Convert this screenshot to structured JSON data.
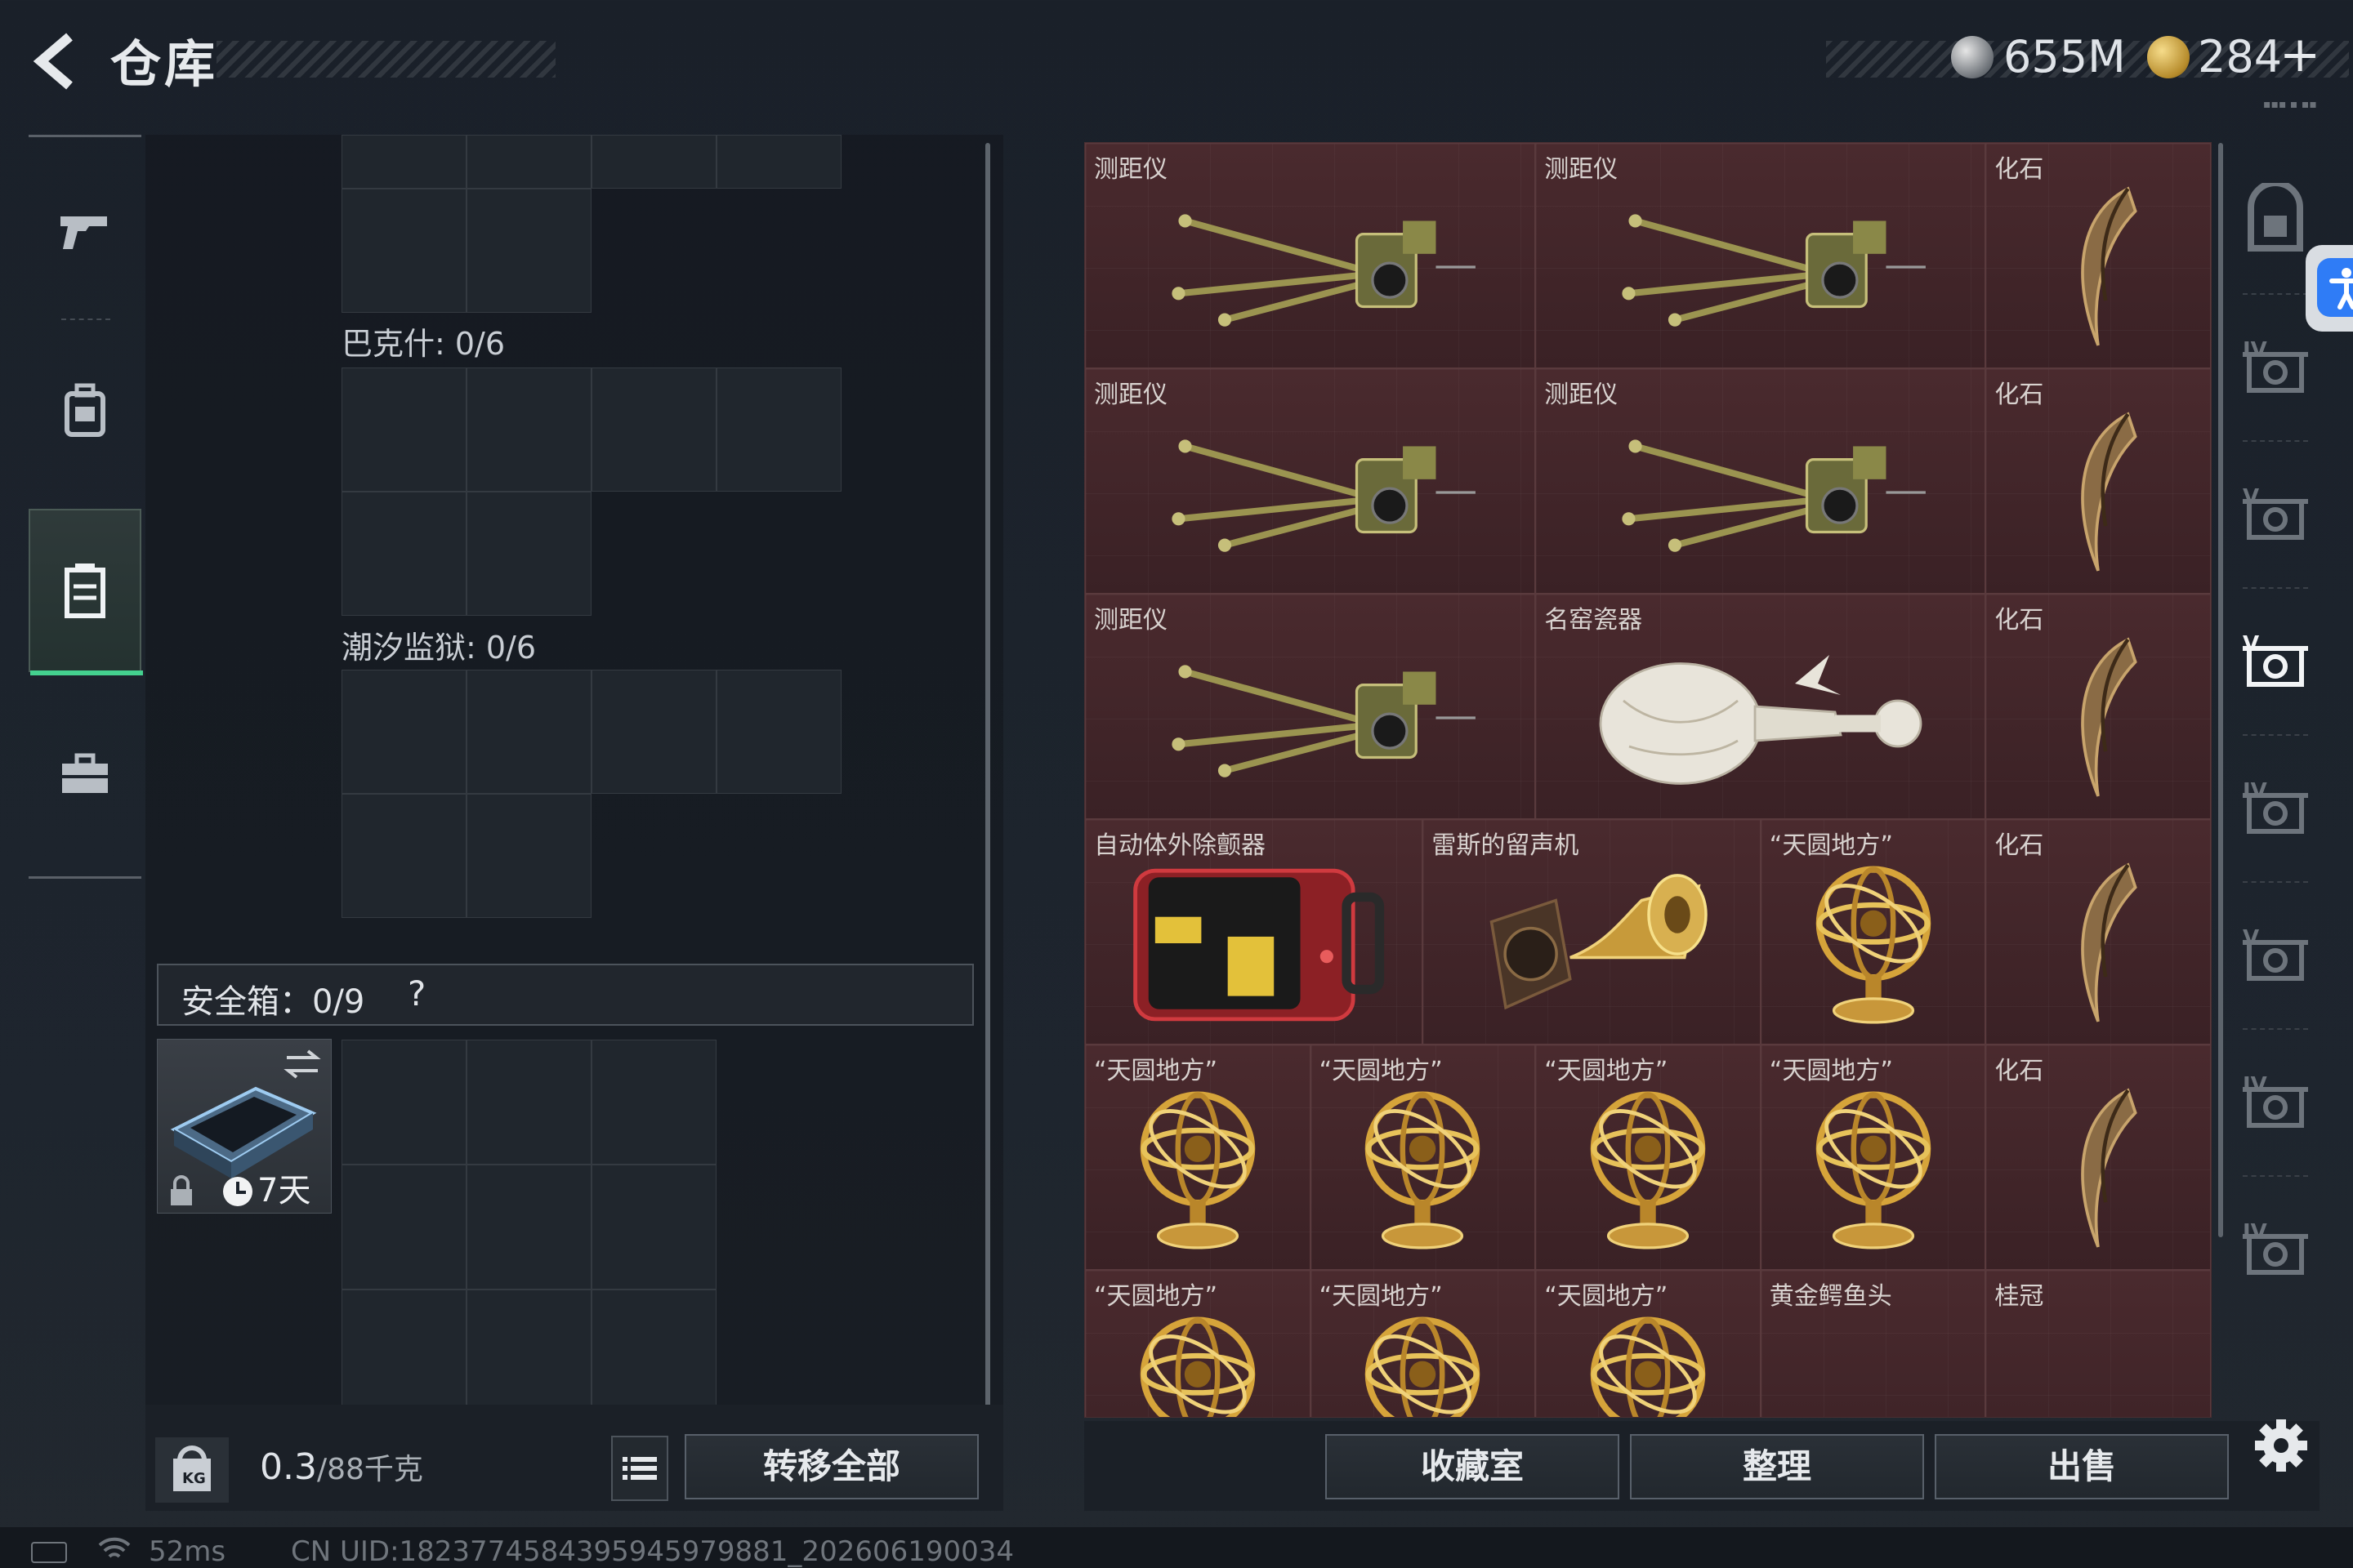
{
  "header": {
    "title": "仓库",
    "silver_amount": "655M",
    "gold_amount": "284",
    "plus_label": "+",
    "mini_label": "▪▪▪ ▪ ▪▪"
  },
  "left_nav": {
    "items": [
      {
        "icon": "pistol-icon"
      },
      {
        "icon": "backpack-icon"
      },
      {
        "icon": "container-icon",
        "active": true
      },
      {
        "icon": "toolbox-icon"
      }
    ]
  },
  "middle": {
    "sections": [
      {
        "label": "巴克什: 0/6"
      },
      {
        "label": "潮汐监狱: 0/6"
      }
    ],
    "safe_box": {
      "label": "安全箱：0/9",
      "help": "?",
      "duration": "7天",
      "swap_icon": "swap-icon",
      "lock_icon": "lock-icon"
    },
    "weight": {
      "current": "0.3",
      "max": "/88千克",
      "icon_text": "KG"
    }
  },
  "actions": {
    "transfer_all": "转移全部",
    "collection": "收藏室",
    "organize": "整理",
    "sell": "出售"
  },
  "stash_items": [
    {
      "name": "测距仪",
      "icon": "rangefinder"
    },
    {
      "name": "测距仪",
      "icon": "rangefinder"
    },
    {
      "name": "化石",
      "icon": "fossil-claw"
    },
    {
      "name": "测距仪",
      "icon": "rangefinder"
    },
    {
      "name": "测距仪",
      "icon": "rangefinder"
    },
    {
      "name": "化石",
      "icon": "fossil-claw"
    },
    {
      "name": "测距仪",
      "icon": "rangefinder"
    },
    {
      "name": "名窑瓷器",
      "icon": "porcelain-vase"
    },
    {
      "name": "化石",
      "icon": "fossil-claw"
    },
    {
      "name": "自动体外除颤器",
      "icon": "aed"
    },
    {
      "name": "雷斯的留声机",
      "icon": "gramophone"
    },
    {
      "name": "“天圆地方”",
      "icon": "armillary-sphere"
    },
    {
      "name": "化石",
      "icon": "fossil-claw"
    },
    {
      "name": "“天圆地方”",
      "icon": "armillary-sphere"
    },
    {
      "name": "“天圆地方”",
      "icon": "armillary-sphere"
    },
    {
      "name": "“天圆地方”",
      "icon": "armillary-sphere"
    },
    {
      "name": "“天圆地方”",
      "icon": "armillary-sphere"
    },
    {
      "name": "化石",
      "icon": "fossil-claw"
    },
    {
      "name": "“天圆地方”",
      "icon": "armillary-sphere"
    },
    {
      "name": "“天圆地方”",
      "icon": "armillary-sphere"
    },
    {
      "name": "“天圆地方”",
      "icon": "armillary-sphere"
    },
    {
      "name": "黄金鳄鱼头",
      "icon": "gold-croc-head"
    },
    {
      "name": "桂冠",
      "icon": "laurel"
    }
  ],
  "right_sidebar": {
    "items": [
      {
        "label": "",
        "icon": "safe-slot-icon"
      },
      {
        "label": "IV",
        "icon": "tier-box-icon"
      },
      {
        "label": "V",
        "icon": "tier-box-icon"
      },
      {
        "label": "V",
        "icon": "tier-box-icon",
        "active": true
      },
      {
        "label": "IV",
        "icon": "tier-box-icon"
      },
      {
        "label": "V",
        "icon": "tier-box-icon"
      },
      {
        "label": "IV",
        "icon": "tier-box-icon"
      },
      {
        "label": "IV",
        "icon": "tier-box-icon"
      }
    ]
  },
  "status_bar": {
    "ping": "52ms",
    "uid": "CN UID:18237745843959459798​81_202606190034"
  },
  "colors": {
    "accent_green": "#44d18f",
    "stash_bg": "#3c2327",
    "a11y_blue": "#2f7cf6"
  }
}
